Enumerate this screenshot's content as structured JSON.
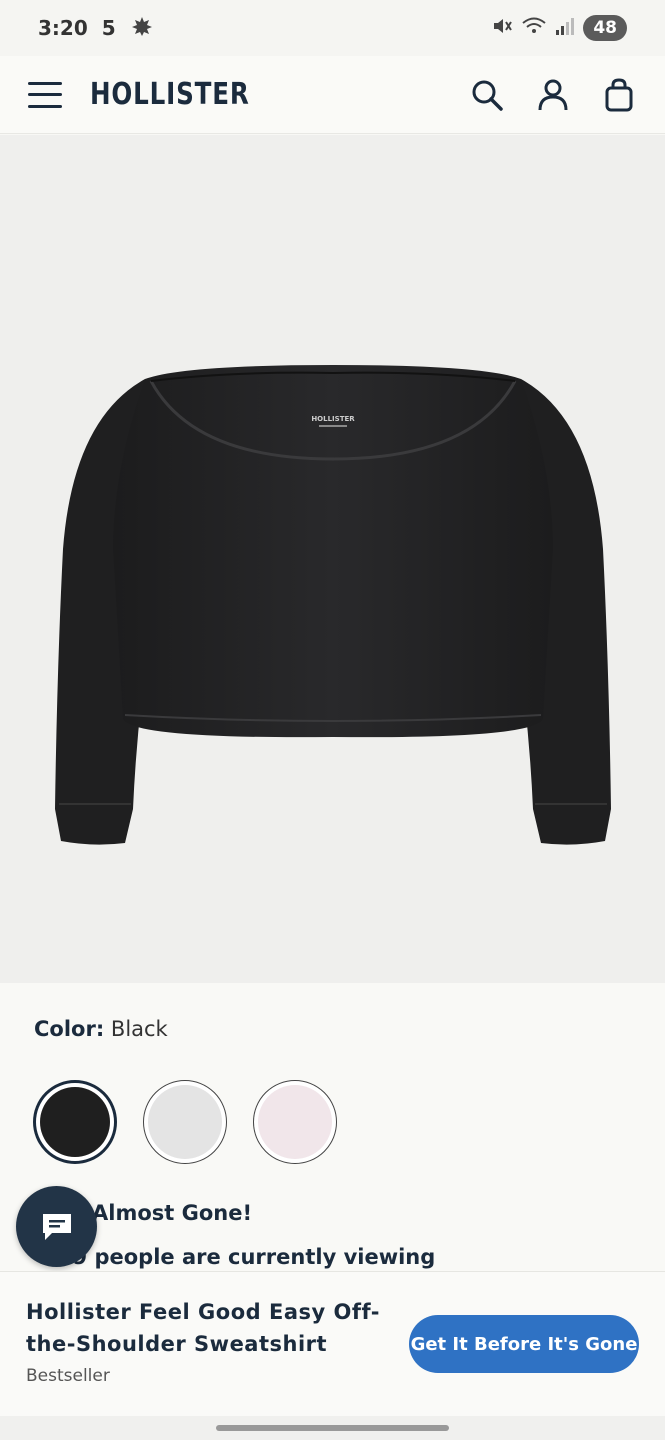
{
  "status_bar": {
    "time": "3:20",
    "notification_count": "5",
    "battery": "48"
  },
  "header": {
    "brand": "HOLLISTER",
    "icons": [
      "menu-icon",
      "search-icon",
      "account-icon",
      "bag-icon"
    ]
  },
  "product": {
    "image_alt": "black off-the-shoulder sweatshirt",
    "image_tag_text": "HOLLISTER",
    "color_label": "Color:",
    "color_value": "Black",
    "swatches": [
      {
        "name": "Black",
        "hex": "#1f1f1f",
        "selected": true
      },
      {
        "name": "Light Grey",
        "hex": "#e4e4e4",
        "selected": false
      },
      {
        "name": "Light Pink",
        "hex": "#f1e6ea",
        "selected": false
      }
    ],
    "urgency": "Almost Gone!",
    "viewing_text": "6  39 people are currently viewing"
  },
  "bottom_bar": {
    "title": "Hollister Feel Good Easy Off-the-Shoulder Sweatshirt",
    "badge": "Bestseller",
    "cta": "Get It Before It's Gone"
  },
  "colors": {
    "navy": "#1b2b3d",
    "cta_blue": "#2f72c4",
    "image_bg": "#efefed"
  }
}
